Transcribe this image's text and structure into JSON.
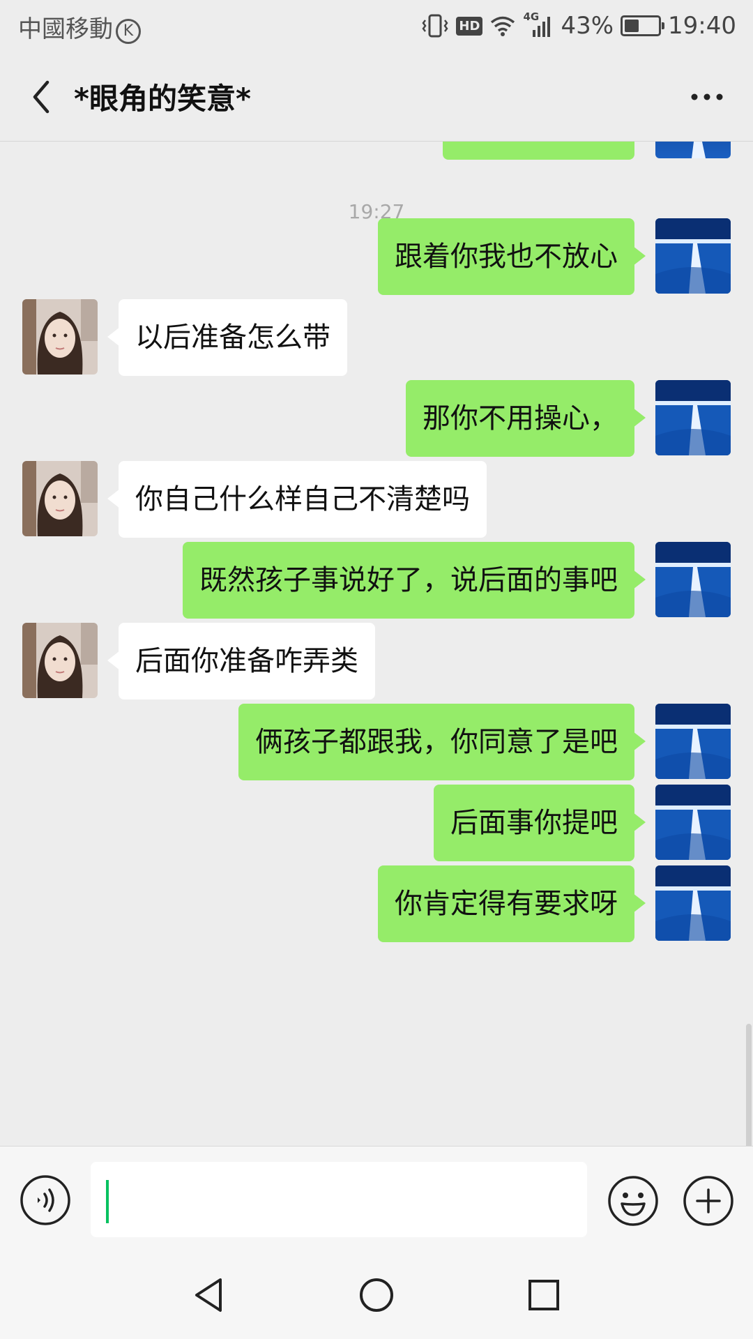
{
  "status_bar": {
    "carrier": "中國移動",
    "carrier_badge": "K",
    "hd": "HD",
    "network": "4G",
    "battery_text": "43%",
    "battery_level": 0.43,
    "time": "19:40"
  },
  "header": {
    "title": "*眼角的笑意*",
    "back_icon": "chevron-left-icon",
    "more_icon": "more-dots-icon"
  },
  "chat": {
    "timestamp": "19:27",
    "messages": [
      {
        "from": "me",
        "text": "跟着你我也不放心"
      },
      {
        "from": "contact",
        "text": "以后准备怎么带"
      },
      {
        "from": "me",
        "text": "那你不用操心，"
      },
      {
        "from": "contact",
        "text": "你自己什么样自己不清楚吗"
      },
      {
        "from": "me",
        "text": "既然孩子事说好了，说后面的事吧"
      },
      {
        "from": "contact",
        "text": "后面你准备咋弄类"
      },
      {
        "from": "me",
        "text": "俩孩子都跟我，你同意了是吧"
      },
      {
        "from": "me",
        "text": "后面事你提吧"
      },
      {
        "from": "me",
        "text": "你肯定得有要求呀"
      }
    ]
  },
  "input_bar": {
    "voice_icon": "voice-icon",
    "text_value": "",
    "emoji_icon": "emoji-icon",
    "plus_icon": "plus-icon"
  },
  "nav_bar": {
    "back_icon": "nav-back-icon",
    "home_icon": "nav-home-icon",
    "recent_icon": "nav-recent-icon"
  },
  "colors": {
    "sent_bubble": "#95ec69",
    "received_bubble": "#ffffff",
    "background": "#ededed",
    "cursor": "#07c160"
  }
}
